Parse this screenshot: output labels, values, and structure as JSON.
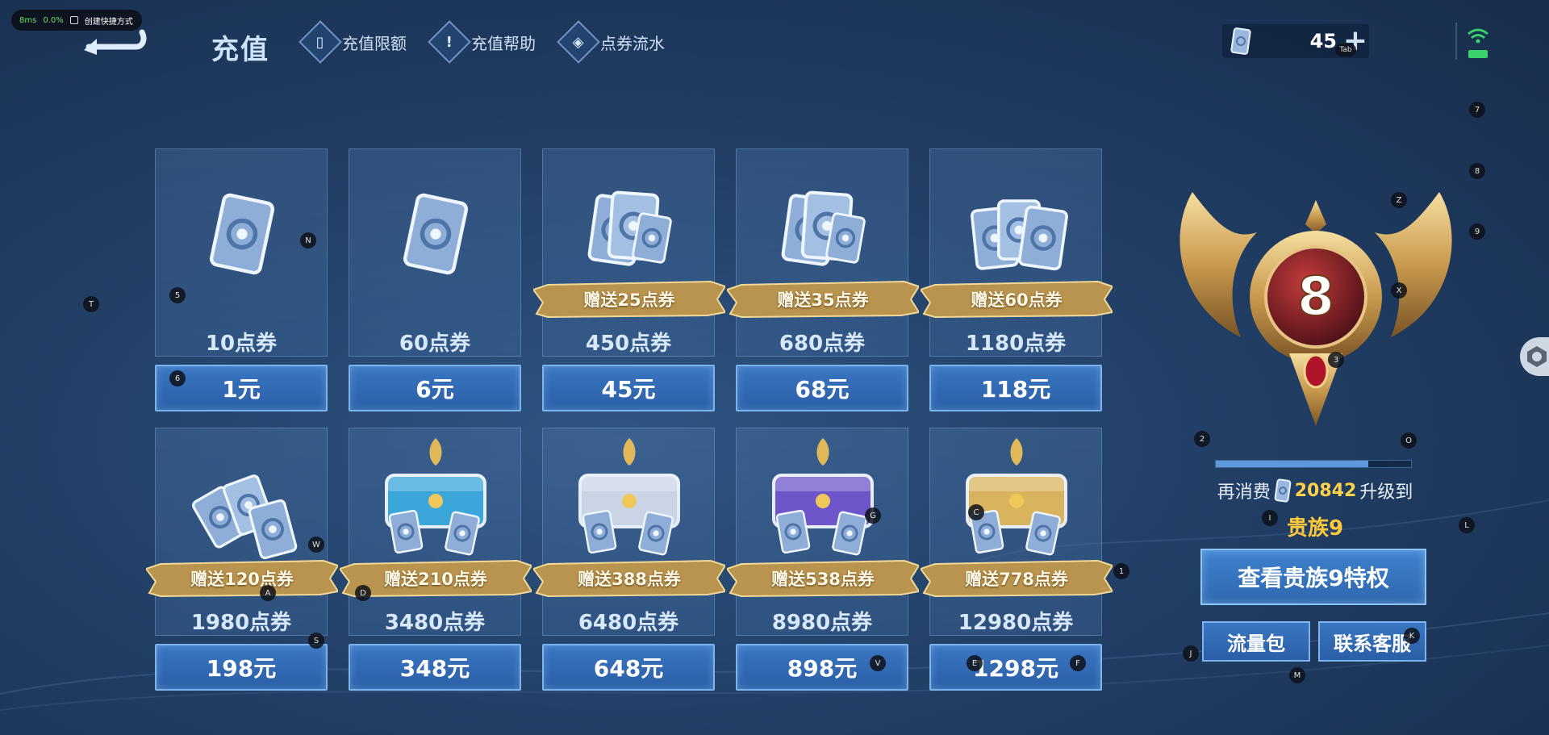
{
  "overlay": {
    "latency": "8ms",
    "cpu": "0.0%",
    "shortcut_label": "创建快捷方式"
  },
  "header": {
    "title": "充值",
    "links": [
      {
        "label": "充值限额",
        "icon": "card-icon"
      },
      {
        "label": "充值帮助",
        "icon": "exclamation-icon"
      },
      {
        "label": "点券流水",
        "icon": "coupon-icon"
      }
    ],
    "balance": "45",
    "add_symbol": "+",
    "tab_hint": "Tab"
  },
  "products": [
    {
      "points": "10点券",
      "bonus": "",
      "price": "1元",
      "tier": "single"
    },
    {
      "points": "60点券",
      "bonus": "",
      "price": "6元",
      "tier": "single"
    },
    {
      "points": "450点券",
      "bonus": "赠送25点券",
      "price": "45元",
      "tier": "small-stack"
    },
    {
      "points": "680点券",
      "bonus": "赠送35点券",
      "price": "68元",
      "tier": "small-stack"
    },
    {
      "points": "1180点券",
      "bonus": "赠送60点券",
      "price": "118元",
      "tier": "stack"
    },
    {
      "points": "1980点券",
      "bonus": "赠送120点券",
      "price": "198元",
      "tier": "big-stack"
    },
    {
      "points": "3480点券",
      "bonus": "赠送210点券",
      "price": "348元",
      "tier": "chest-blue"
    },
    {
      "points": "6480点券",
      "bonus": "赠送388点券",
      "price": "648元",
      "tier": "chest-silver"
    },
    {
      "points": "8980点券",
      "bonus": "赠送538点券",
      "price": "898元",
      "tier": "chest-purple"
    },
    {
      "points": "12980点券",
      "bonus": "赠送778点券",
      "price": "1298元",
      "tier": "chest-gold"
    }
  ],
  "noble": {
    "level": "8",
    "progress": 0.78,
    "spend_prefix": "再消费",
    "spend_amount": "20842",
    "spend_suffix": "升级到",
    "next_level": "贵族9",
    "privilege_button": "查看贵族9特权",
    "traffic_button": "流量包",
    "support_button": "联系客服"
  },
  "hotkeys": [
    "N",
    "5",
    "T",
    "6",
    "W",
    "A",
    "D",
    "S",
    "G",
    "C",
    "V",
    "E",
    "F",
    "1",
    "Z",
    "9",
    "X",
    "3",
    "2",
    "O",
    "I",
    "L",
    "J",
    "K",
    "M",
    "7",
    "8"
  ],
  "colors": {
    "accent": "#3a76c2",
    "gold": "#ffc93c",
    "bonus_ribbon": "#b8944e"
  }
}
